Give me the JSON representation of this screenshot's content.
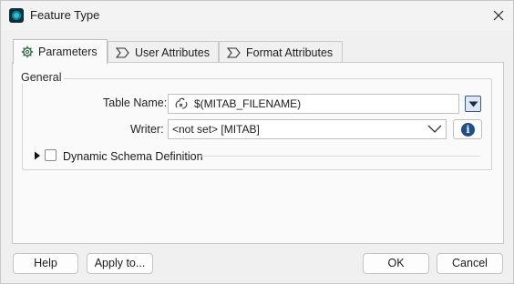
{
  "window": {
    "title": "Feature Type"
  },
  "tabs": [
    {
      "label": "Parameters",
      "active": true
    },
    {
      "label": "User Attributes",
      "active": false
    },
    {
      "label": "Format Attributes",
      "active": false
    }
  ],
  "general": {
    "group_title": "General",
    "table_name_label": "Table Name:",
    "table_name_value": "$(MITAB_FILENAME)",
    "writer_label": "Writer:",
    "writer_value": "<not set> [MITAB]"
  },
  "dynamic_schema": {
    "label": "Dynamic Schema Definition",
    "checked": false,
    "expanded": false
  },
  "buttons": {
    "help": "Help",
    "apply_to": "Apply to...",
    "ok": "OK",
    "cancel": "Cancel"
  },
  "colors": {
    "accent": "#1f4f8b",
    "app_icon": "#24c2d8"
  }
}
